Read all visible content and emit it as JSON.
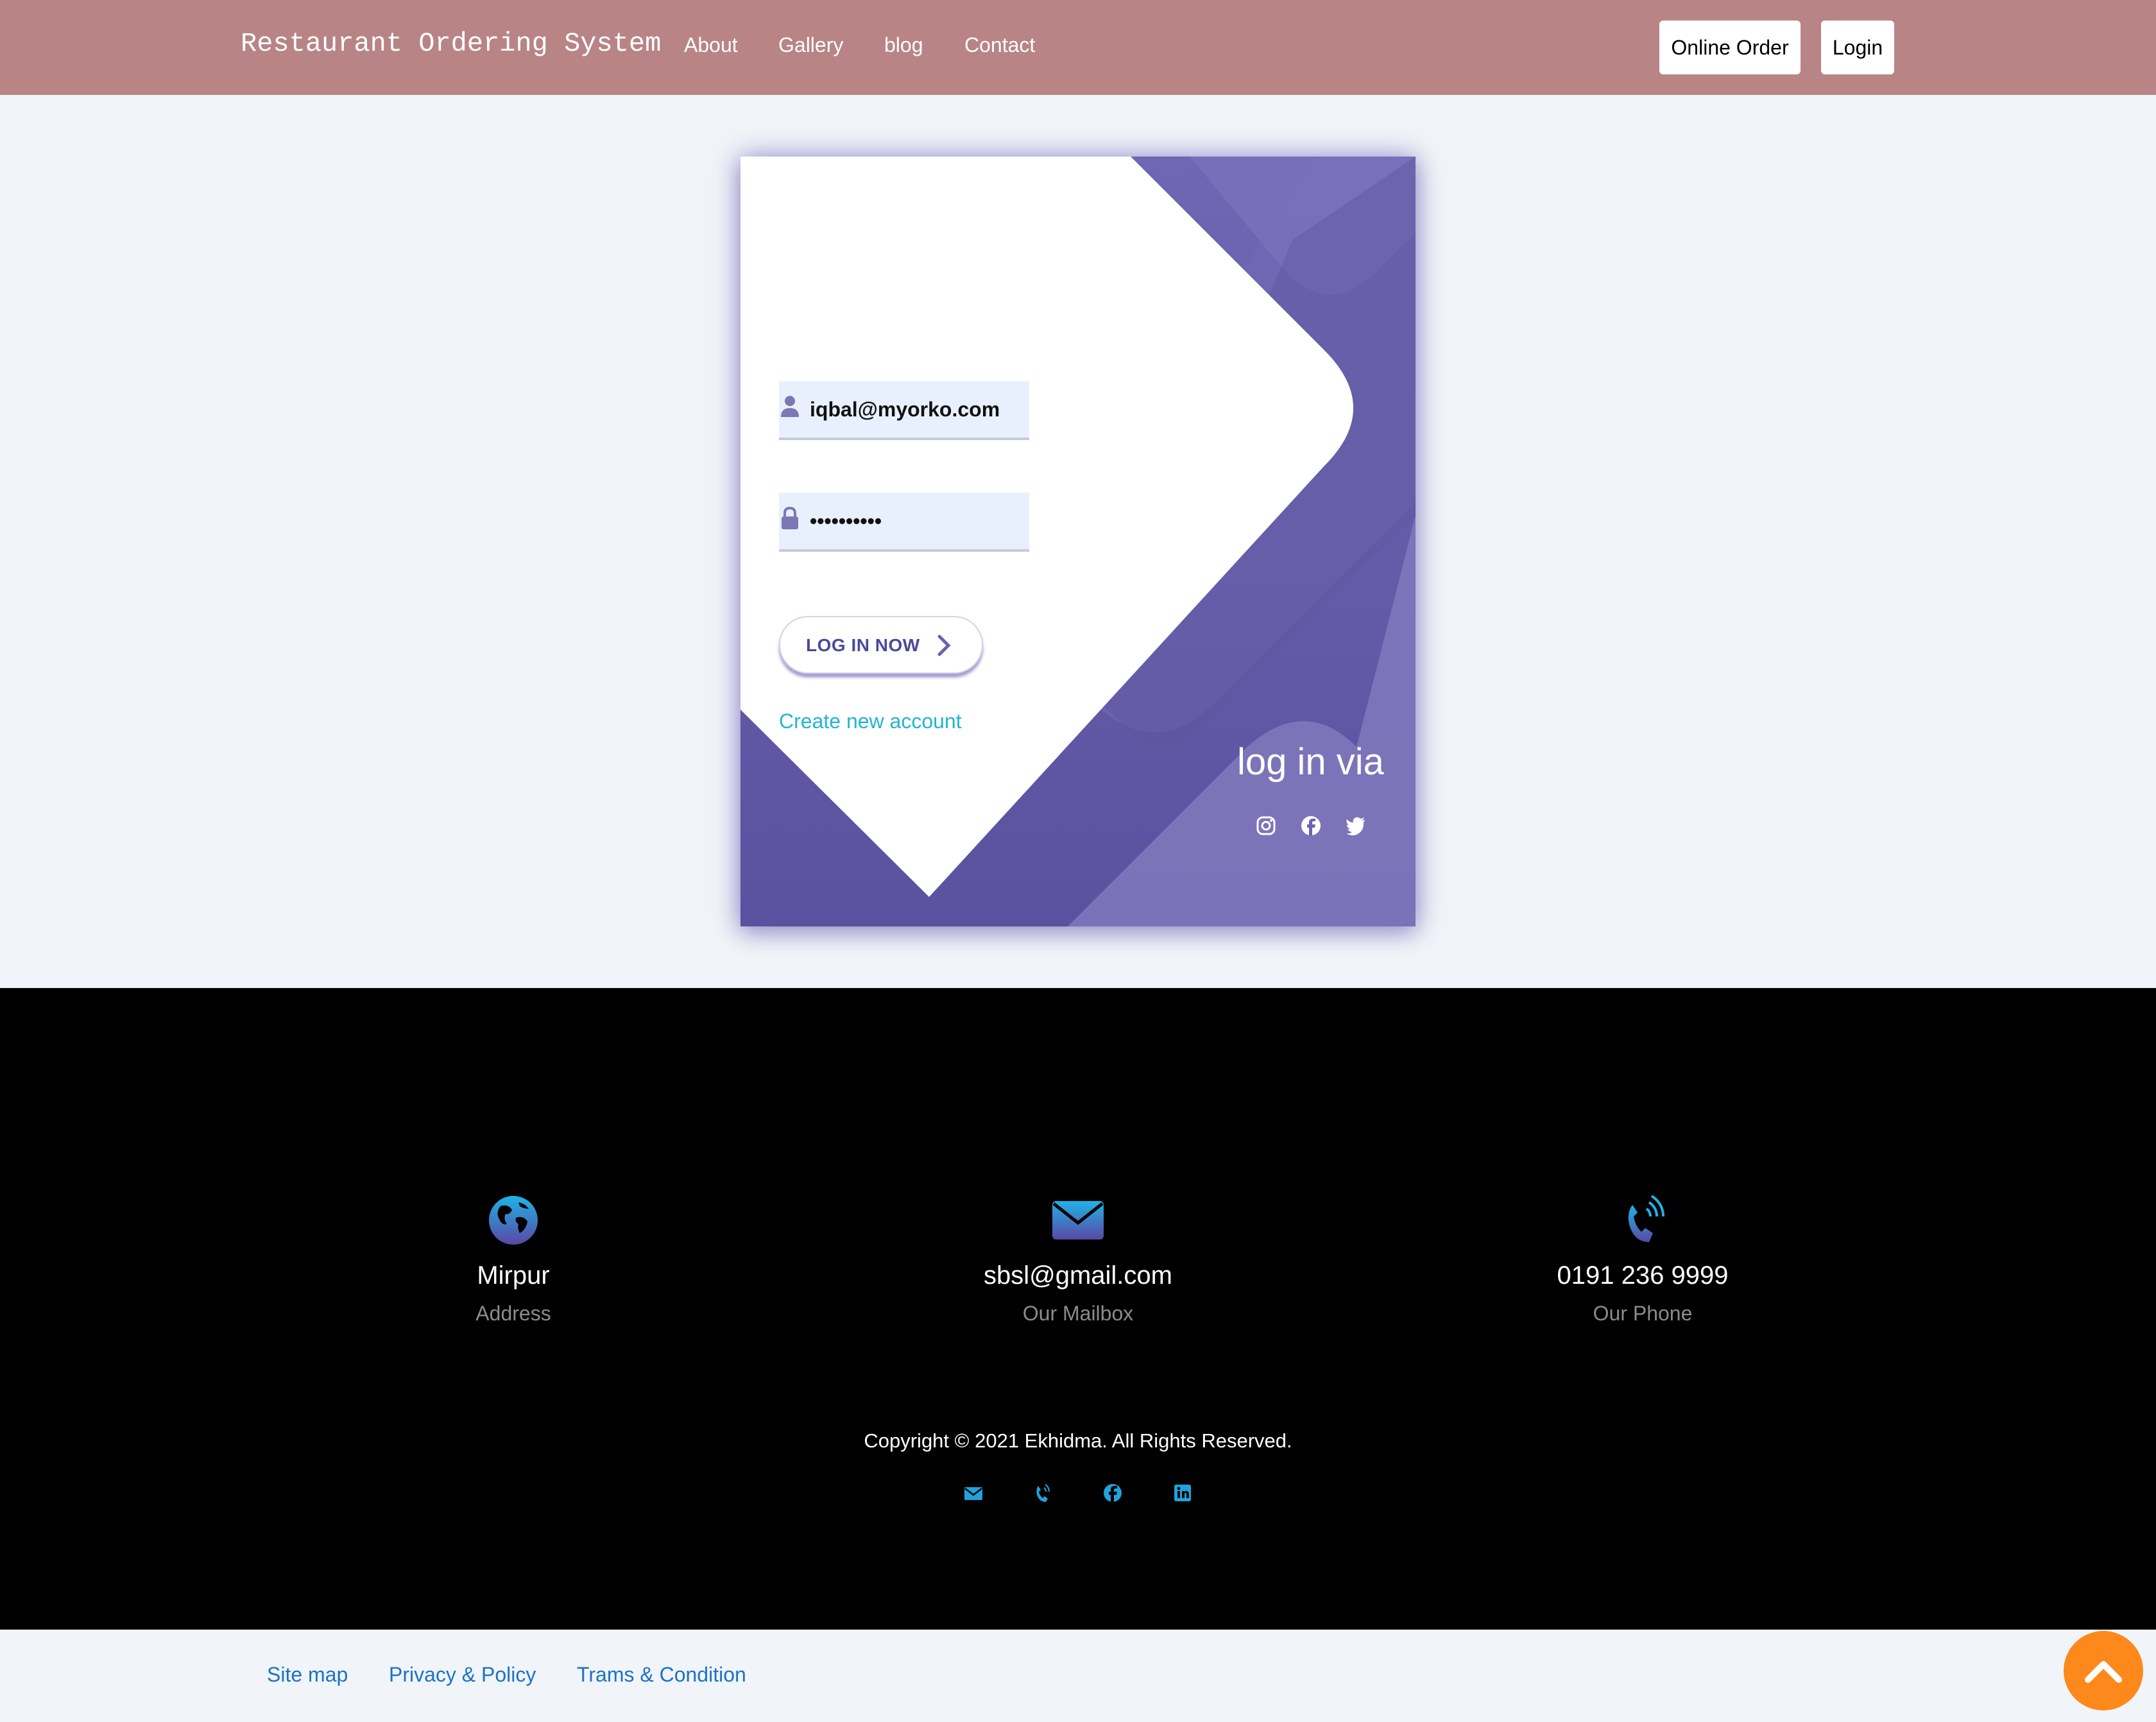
{
  "navbar": {
    "brand": "Restaurant Ordering System",
    "links": [
      "About",
      "Gallery",
      "blog",
      "Contact"
    ],
    "online_order_label": "Online Order",
    "login_label": "Login",
    "background": "#b88486"
  },
  "login_form": {
    "email_value": "iqbal@myorko.com",
    "password_value": "••••••••••",
    "login_button_label": "LOG IN NOW",
    "create_account_link": "Create new account",
    "social_title": "log in via",
    "social_icons": [
      "instagram-icon",
      "facebook-icon",
      "twitter-icon"
    ],
    "accent_color": "#6a62b0"
  },
  "footer": {
    "address": {
      "value": "Mirpur",
      "label": "Address",
      "icon": "globe-icon"
    },
    "mail": {
      "value": "sbsl@gmail.com",
      "label": "Our Mailbox",
      "icon": "envelope-icon"
    },
    "phone": {
      "value": "0191 236 9999",
      "label": "Our Phone",
      "icon": "phone-icon"
    },
    "copyright": "Copyright © 2021 Ekhidma. All Rights Reserved.",
    "social_icons": [
      "envelope-icon",
      "phone-icon",
      "facebook-icon",
      "linkedin-icon"
    ]
  },
  "bottom_links": [
    "Site map",
    "Privacy & Policy",
    "Trams & Condition"
  ],
  "scroll_top": {
    "icon": "chevron-up-icon",
    "color": "#fd891c"
  }
}
